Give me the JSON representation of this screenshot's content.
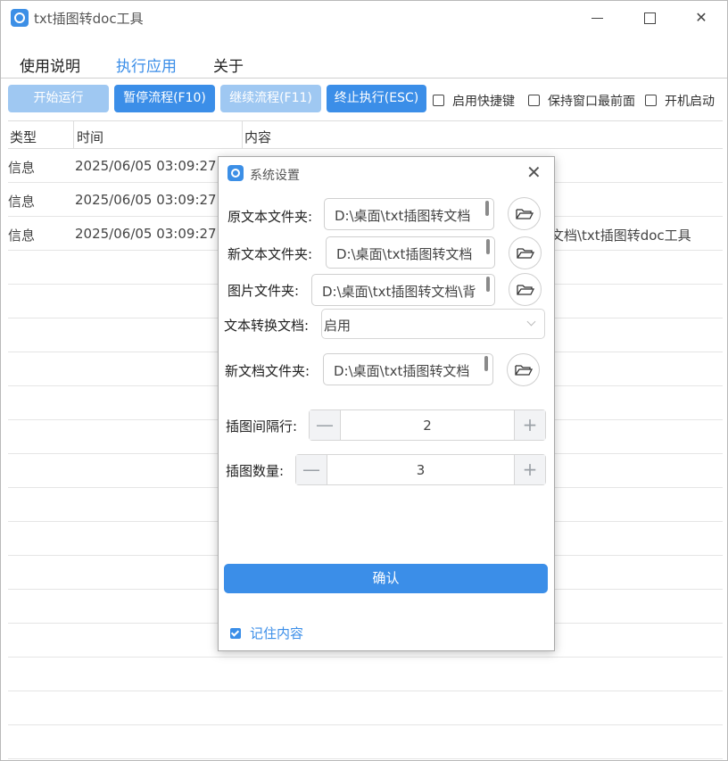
{
  "window": {
    "title": "txt插图转doc工具"
  },
  "menu": [
    {
      "label": "使用说明",
      "active": false
    },
    {
      "label": "执行应用",
      "active": true
    },
    {
      "label": "关于",
      "active": false
    }
  ],
  "toolbar": {
    "start_label": "开始运行",
    "pause_label": "暂停流程(F10)",
    "resume_label": "继续流程(F11)",
    "stop_label": "终止执行(ESC)",
    "hotkey_label": "启用快捷键",
    "topmost_label": "保持窗口最前面",
    "autostart_label": "开机启动"
  },
  "table": {
    "headers": [
      "类型",
      "时间",
      "内容"
    ],
    "rows": [
      {
        "type": "信息",
        "time": "2025/06/05 03:09:27",
        "content": ""
      },
      {
        "type": "信息",
        "time": "2025/06/05 03:09:27",
        "content": ""
      },
      {
        "type": "信息",
        "time": "2025/06/05 03:09:27",
        "content": "文档\\txt插图转doc工具"
      }
    ]
  },
  "dialog": {
    "title": "系统设置",
    "source_folder": {
      "label": "原文本文件夹:",
      "value": "D:\\桌面\\txt插图转文档"
    },
    "new_text_folder": {
      "label": "新文本文件夹:",
      "value": "D:\\桌面\\txt插图转文档"
    },
    "image_folder": {
      "label": "图片文件夹:",
      "value": "D:\\桌面\\txt插图转文档\\背"
    },
    "convert": {
      "label": "文本转换文档:",
      "value": "启用"
    },
    "new_doc_folder": {
      "label": "新文档文件夹:",
      "value": "D:\\桌面\\txt插图转文档"
    },
    "interval": {
      "label": "插图间隔行:",
      "value": "2"
    },
    "count": {
      "label": "插图数量:",
      "value": "3"
    },
    "confirm_label": "确认",
    "remember_label": "记住内容",
    "remember_checked": true
  },
  "colors": {
    "accent": "#3b8ee8",
    "accent_disabled": "#9fc8f2"
  }
}
